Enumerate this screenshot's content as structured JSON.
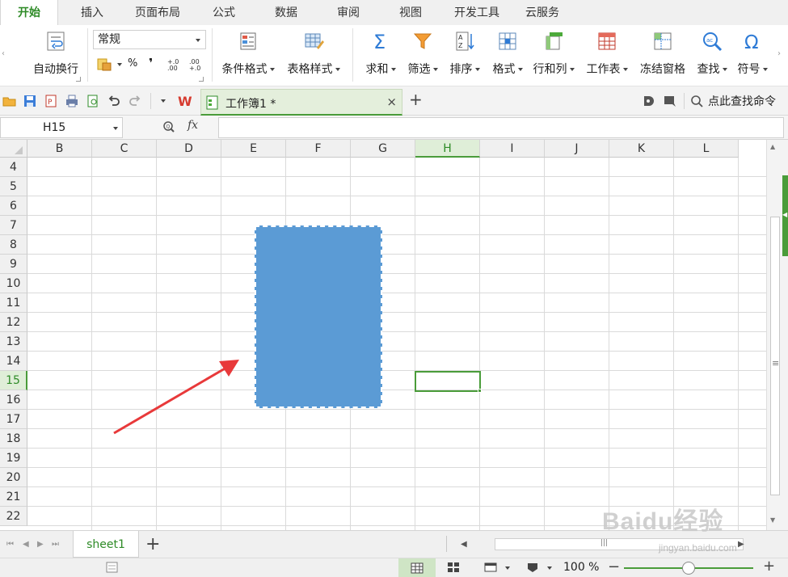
{
  "menu": {
    "tabs": [
      {
        "label": "开始",
        "active": true
      },
      {
        "label": "插入"
      },
      {
        "label": "页面布局"
      },
      {
        "label": "公式"
      },
      {
        "label": "数据"
      },
      {
        "label": "审阅"
      },
      {
        "label": "视图"
      },
      {
        "label": "开发工具"
      },
      {
        "label": "云服务"
      }
    ]
  },
  "ribbon": {
    "wrap_text": "自动换行",
    "number_format": "常规",
    "percent": "%",
    "comma": "❜",
    "inc_decimal": "+.0 .00",
    "dec_decimal": ".00 +.0",
    "conditional_format": "条件格式",
    "table_style": "表格样式",
    "sum": "求和",
    "filter": "筛选",
    "sort": "排序",
    "format": "格式",
    "row_col": "行和列",
    "worksheet": "工作表",
    "freeze": "冻结窗格",
    "find": "查找",
    "symbol": "符号"
  },
  "quickbar": {
    "doc_title": "工作簿1 *",
    "find_command": "点此查找命令",
    "close_glyph": "×",
    "new_tab_glyph": "+"
  },
  "formula_bar": {
    "name_box": "H15",
    "fx_label": "fx",
    "value": ""
  },
  "grid": {
    "columns": [
      "B",
      "C",
      "D",
      "E",
      "F",
      "G",
      "H",
      "I",
      "J",
      "K",
      "L"
    ],
    "selected_column": "H",
    "rows": [
      "4",
      "5",
      "6",
      "7",
      "8",
      "9",
      "10",
      "11",
      "12",
      "13",
      "14",
      "15",
      "16",
      "17",
      "18",
      "19",
      "20",
      "21",
      "22"
    ],
    "selected_row": "15",
    "shape_color": "#5b9bd5",
    "arrow_color": "#e8393a"
  },
  "sheets": {
    "tabs": [
      "sheet1"
    ],
    "add_glyph": "+"
  },
  "status": {
    "zoom": "100 %"
  },
  "watermark": {
    "text": "Baidu经验",
    "sub": "jingyan.baidu.com"
  }
}
